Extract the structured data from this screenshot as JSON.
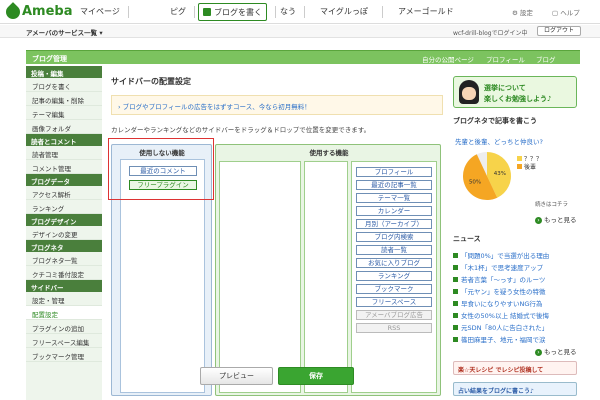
{
  "header": {
    "logo_text": "Ameba",
    "nav": [
      "マイページ",
      "ピグ",
      "ブログを書く",
      "なう",
      "マイグルっぽ",
      "アメーゴールド"
    ],
    "settings": "設定",
    "help": "ヘルプ"
  },
  "subbar": {
    "service_list": "アメーバのサービス一覧 ▾",
    "login_status": "wcf-drill-blogでログイン中",
    "logout": "ログアウト"
  },
  "page_bar": {
    "title": "ブログ管理",
    "links": [
      "自分の公開ページ",
      "プロフィール",
      "ブログ"
    ]
  },
  "sidebar": [
    {
      "type": "head",
      "label": "投稿・編集"
    },
    {
      "type": "item",
      "label": "ブログを書く"
    },
    {
      "type": "item",
      "label": "記事の編集・削除"
    },
    {
      "type": "item",
      "label": "テーマ編集"
    },
    {
      "type": "item",
      "label": "画像フォルダ"
    },
    {
      "type": "head",
      "label": "読者とコメント"
    },
    {
      "type": "item",
      "label": "読者管理"
    },
    {
      "type": "item",
      "label": "コメント管理"
    },
    {
      "type": "head",
      "label": "ブログデータ"
    },
    {
      "type": "item",
      "label": "アクセス解析"
    },
    {
      "type": "item",
      "label": "ランキング"
    },
    {
      "type": "head",
      "label": "ブログデザイン"
    },
    {
      "type": "item",
      "label": "デザインの変更"
    },
    {
      "type": "head",
      "label": "ブログネタ"
    },
    {
      "type": "item",
      "label": "ブログネタ一覧"
    },
    {
      "type": "item",
      "label": "クチコミ番付設定"
    },
    {
      "type": "head",
      "label": "サイドバー"
    },
    {
      "type": "item",
      "label": "設定・管理"
    },
    {
      "type": "item",
      "label": "配置設定",
      "selected": true
    },
    {
      "type": "item",
      "label": "プラグインの追加"
    },
    {
      "type": "item",
      "label": "フリースペース編集"
    },
    {
      "type": "item",
      "label": "ブックマーク管理"
    }
  ],
  "main": {
    "title": "サイドバーの配置設定",
    "notice": "› ブログやプロフィールの広告をはずすコース、今なら初月無料！",
    "instruction": "カレンダーやランキングなどのサイドバーをドラッグ＆ドロップで位置を変更できます。",
    "unused_heading": "使用しない機能",
    "unused_widgets": [
      "最近のコメント",
      "フリープラグイン"
    ],
    "used_heading": "使用する機能",
    "used_widgets": [
      "プロフィール",
      "最近の記事一覧",
      "テーマ一覧",
      "カレンダー",
      "月別（アーカイブ）",
      "ブログ内検索",
      "読者一覧",
      "お気に入りブログ",
      "ランキング",
      "ブックマーク",
      "フリースペース",
      "アメーバブログ広告",
      "RSS"
    ],
    "preview": "プレビュー",
    "save": "保存"
  },
  "right": {
    "banner": [
      "選挙について",
      "楽しくお勉強しよう♪"
    ],
    "neta_heading": "ブログネタで記事を書こう",
    "neta_question": "先輩と後輩、どっちと仲良い?",
    "legend": [
      "？？？",
      "後輩"
    ],
    "pie_labels": [
      "43%",
      "50%"
    ],
    "pie_values": [
      43,
      50
    ],
    "vote": "続きはコチラ",
    "more1": "もっと見る",
    "news_heading": "ニュース",
    "news": [
      "「問題0%」で当選が出る理由",
      "「木1杯」で思考速度アップ",
      "若者言葉「〜っす」のルーツ",
      "「元ヤン」を疑う女性の特徴",
      "早食いになりやすいNG行為",
      "女性の50%以上 結婚式で後悔",
      "元SDN「80人に告白された」",
      "篠田麻里子、地元・福岡で涙"
    ],
    "more2": "もっと見る",
    "ads": [
      "楽☆天レシピ でレシピ投稿して",
      "占い結果をブログに書こう♪"
    ],
    "colors": {
      "pie_orange": "#f5a623",
      "pie_yellow": "#f7d34a",
      "brand_green": "#2d8a22"
    }
  }
}
